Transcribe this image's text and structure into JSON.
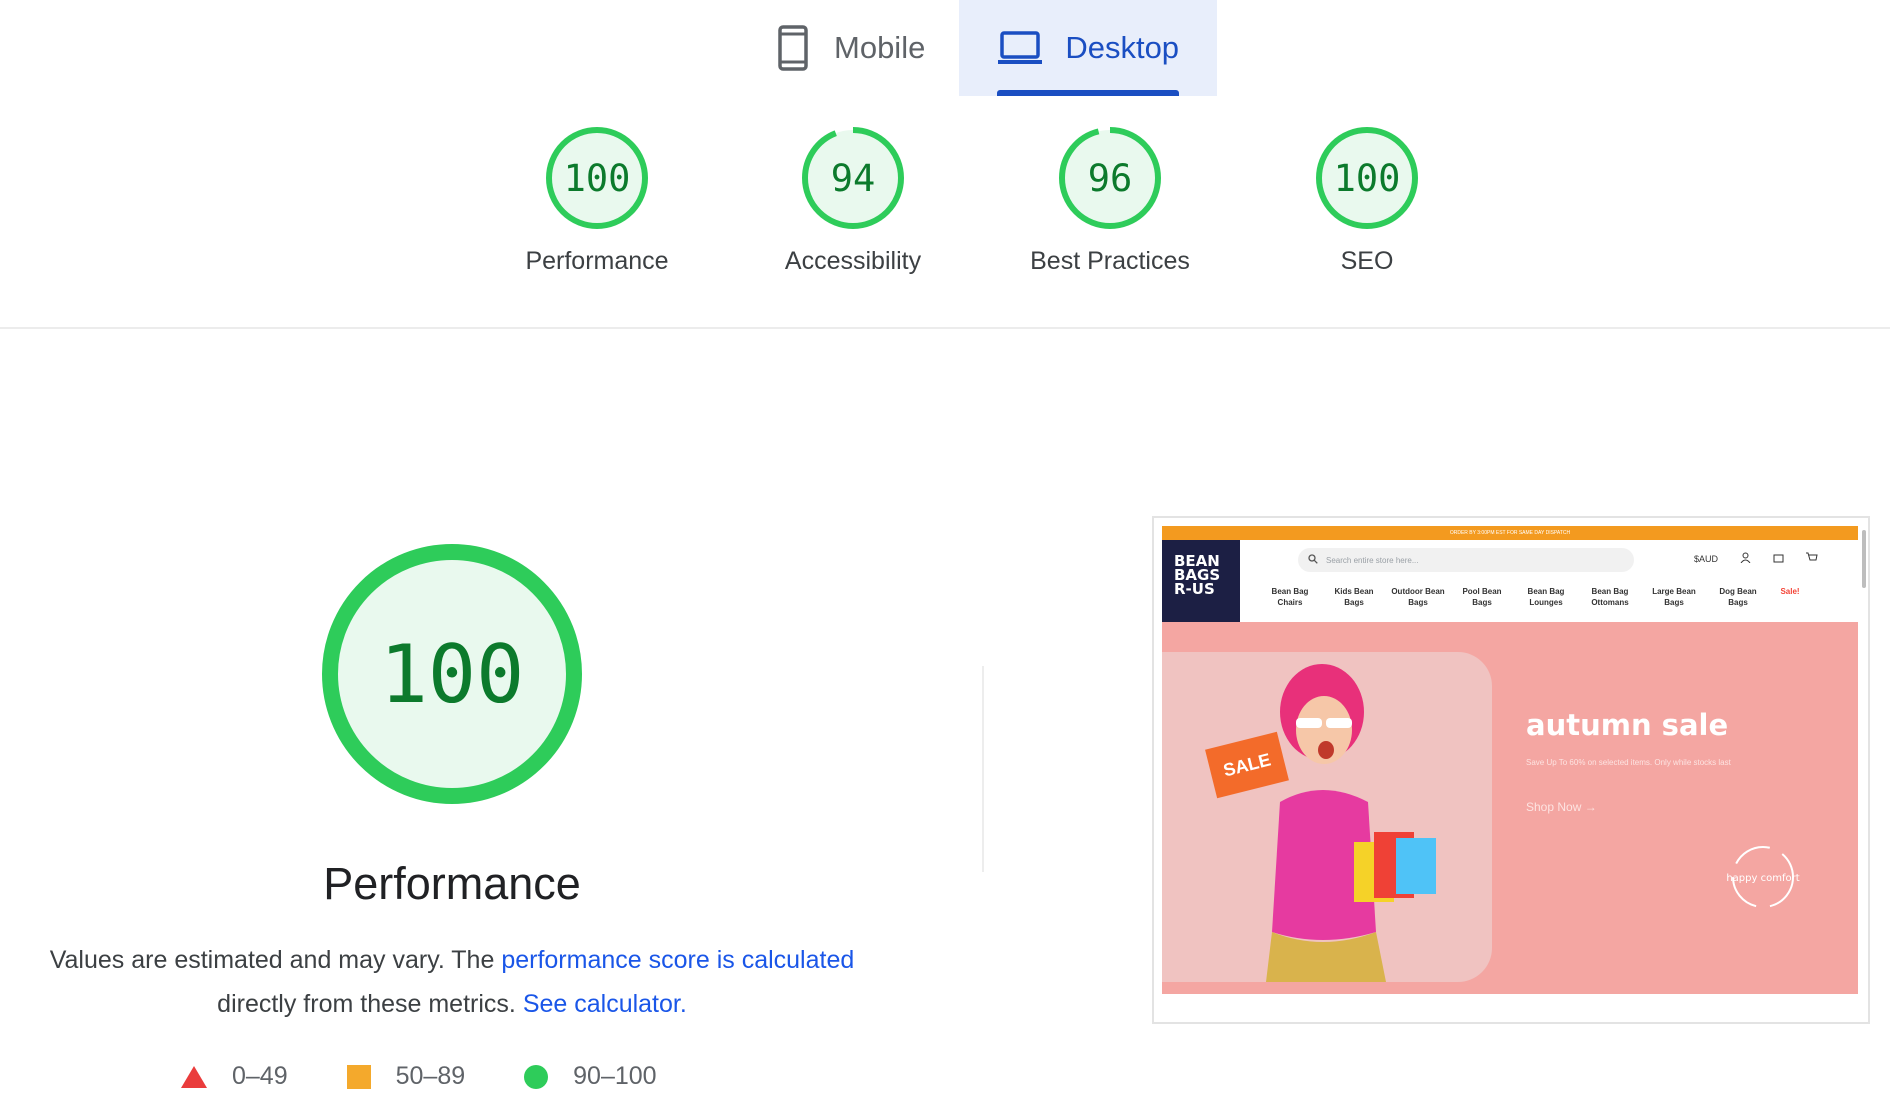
{
  "tabs": [
    {
      "label": "Mobile",
      "icon": "phone-icon",
      "active": false
    },
    {
      "label": "Desktop",
      "icon": "laptop-icon",
      "active": true
    }
  ],
  "categories": [
    {
      "score": "100",
      "label": "Performance",
      "fraction": 1.0
    },
    {
      "score": "94",
      "label": "Accessibility",
      "fraction": 0.94
    },
    {
      "score": "96",
      "label": "Best Practices",
      "fraction": 0.96
    },
    {
      "score": "100",
      "label": "SEO",
      "fraction": 1.0
    }
  ],
  "colors": {
    "pass": "#2ecc5a",
    "pass_bg": "#e9f9ee",
    "pass_text": "#0c7a2c",
    "average": "#f4a92c",
    "fail": "#ea3c3c",
    "link": "#1a56e8",
    "tab_active": "#1a4ec2"
  },
  "performance": {
    "score": "100",
    "fraction": 1.0,
    "title": "Performance",
    "desc_part1": "Values are estimated and may vary. The ",
    "desc_link1": "performance score is calculated",
    "desc_part2": "directly from these metrics. ",
    "desc_link2": "See calculator."
  },
  "legend": [
    {
      "range": "0–49",
      "shape": "triangle"
    },
    {
      "range": "50–89",
      "shape": "square"
    },
    {
      "range": "90–100",
      "shape": "circle"
    }
  ],
  "screenshot": {
    "promo_bar": "ORDER BY 3:00PM EST FOR SAME DAY DISPATCH",
    "logo": [
      "BEAN",
      "BAGS",
      "R-US"
    ],
    "search_placeholder": "Search entire store here...",
    "currency": "$AUD",
    "nav": [
      [
        "Bean Bag",
        "Chairs"
      ],
      [
        "Kids Bean",
        "Bags"
      ],
      [
        "Outdoor Bean",
        "Bags"
      ],
      [
        "Pool Bean",
        "Bags"
      ],
      [
        "Bean Bag",
        "Lounges"
      ],
      [
        "Bean Bag",
        "Ottomans"
      ],
      [
        "Large Bean",
        "Bags"
      ],
      [
        "Dog Bean",
        "Bags"
      ]
    ],
    "nav_sale": "Sale!",
    "hero_title": "autumn sale",
    "hero_sub": "Save Up To 60% on selected items. Only while stocks last",
    "hero_cta": "Shop Now",
    "sale_tag": "SALE",
    "badge_text": "happy comfort"
  }
}
